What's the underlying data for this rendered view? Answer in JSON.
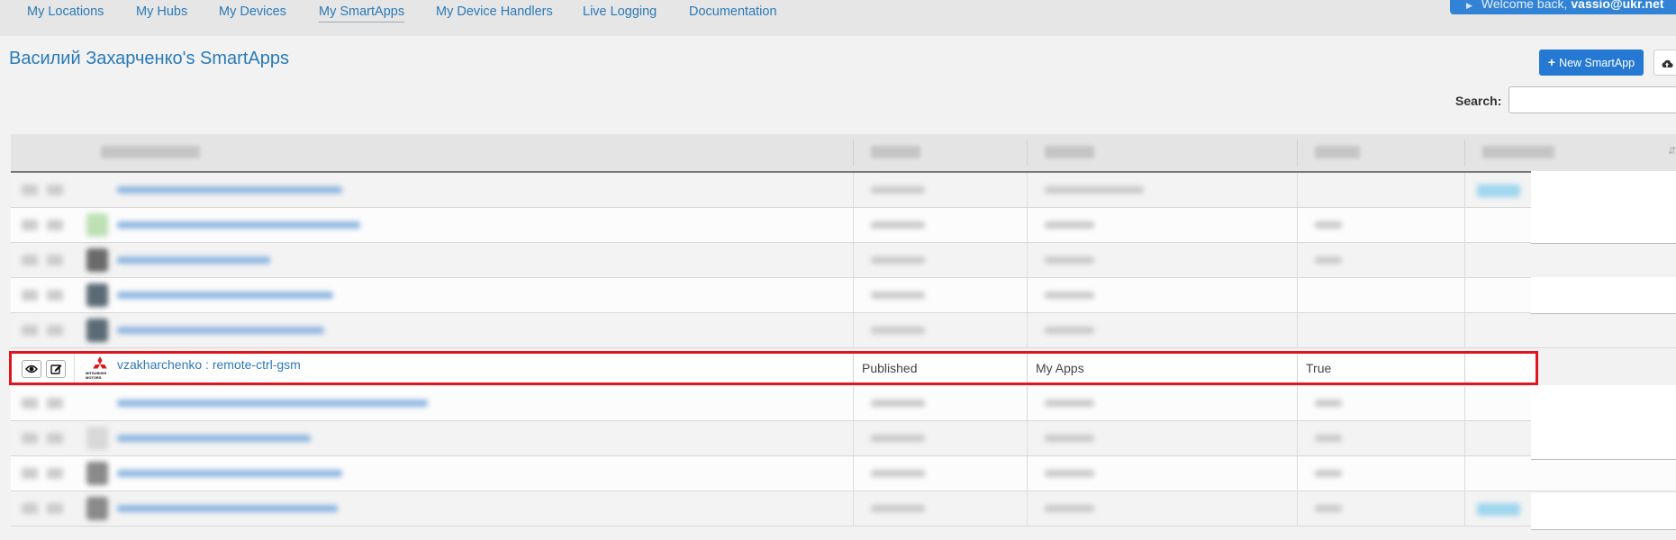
{
  "nav": {
    "links": [
      "My Locations",
      "My Hubs",
      "My Devices",
      "My SmartApps",
      "My Device Handlers",
      "Live Logging",
      "Documentation"
    ],
    "active": "My SmartApps",
    "welcome_prefix": "Welcome back,",
    "welcome_user": "vassio@ukr.net"
  },
  "page": {
    "title": "Василий Захарченко's SmartApps",
    "new_button": "New SmartApp",
    "search_label": "Search:",
    "search_value": ""
  },
  "table": {
    "highlighted_row": {
      "name": "vzakharchenko : remote-ctrl-gsm",
      "logo_label": "MITSUBISHI MOTORS",
      "status": "Published",
      "category": "My Apps",
      "flag": "True"
    }
  },
  "colors": {
    "link": "#2a7ab8",
    "primary_button": "#2679d3",
    "highlight_border": "#e0161e"
  },
  "icons": {
    "view": "eye-icon",
    "edit": "edit-icon",
    "new": "plus-icon",
    "upload": "cloud-upload-icon",
    "welcome": "play-icon"
  }
}
